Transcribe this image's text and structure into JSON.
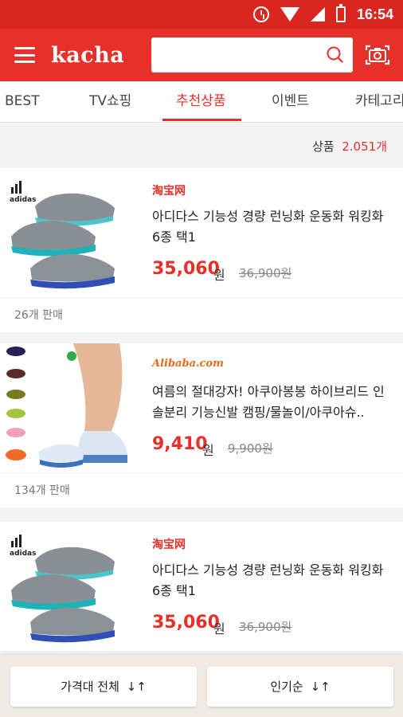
{
  "status_bar": {
    "time": "16:54"
  },
  "header": {
    "logo": "kacha",
    "search_placeholder": ""
  },
  "tabs": [
    {
      "label": "BEST"
    },
    {
      "label": "TV쇼핑"
    },
    {
      "label": "추천상품"
    },
    {
      "label": "이벤트"
    },
    {
      "label": "카테고리"
    }
  ],
  "count": {
    "label": "상품",
    "value": "2.051개"
  },
  "products": [
    {
      "shop": "淘宝网",
      "title": "아디다스 기능성 경량 런닝화 운동화 워킹화 6종 택1",
      "price": "35,060",
      "won": "원",
      "original_price": "36,900원",
      "sold": "26개 판매"
    },
    {
      "shop": "Alibaba.com",
      "title": "여름의 절대강자! 아쿠아봉봉 하이브리드 인솔분리 기능신발 캠핑/물놀이/아쿠아슈..",
      "price": "9,410",
      "won": "원",
      "original_price": "9,900원",
      "sold": "134개 판매"
    },
    {
      "shop": "淘宝网",
      "title": "아디다스 기능성 경량 런닝화 운동화 워킹화 6종 택1",
      "price": "35,060",
      "won": "원",
      "original_price": "36,900원",
      "sold": ""
    }
  ],
  "sort": {
    "price_label": "가격대 전체",
    "popular_label": "인기순",
    "arrows": "↓↑"
  },
  "colors": {
    "brand": "#e8302a",
    "status": "#d9261f"
  }
}
